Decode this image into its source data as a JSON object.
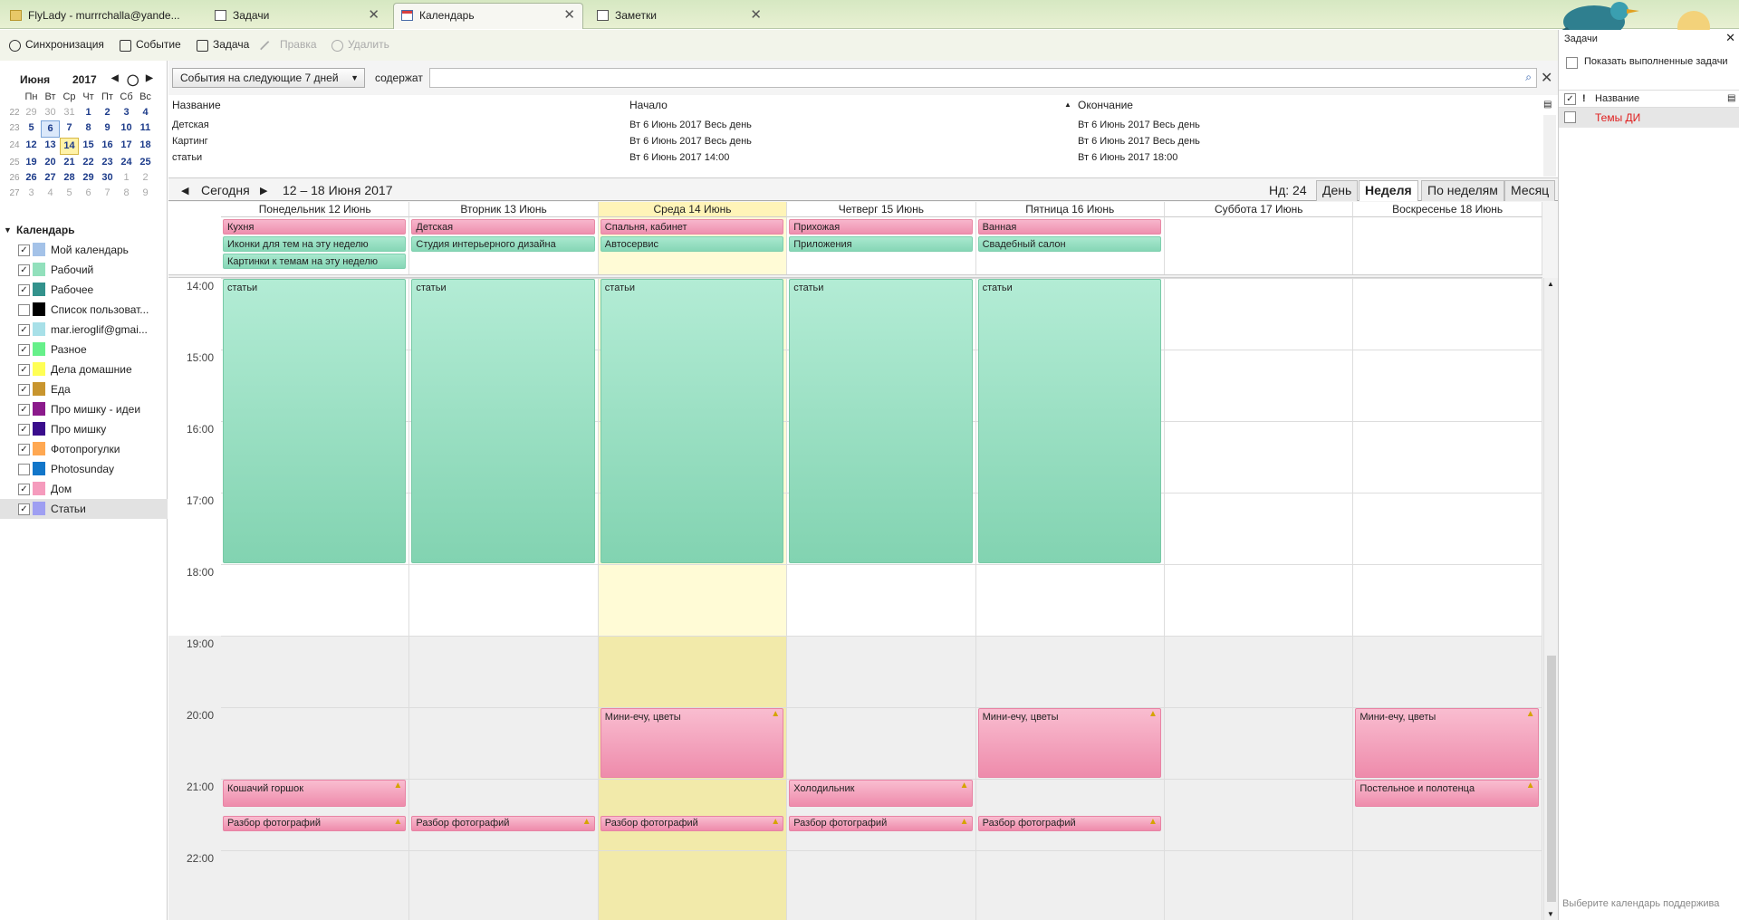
{
  "tabs": [
    {
      "label": "FlyLady - murrrchalla@yande...",
      "icon": "folder-icon"
    },
    {
      "label": "Задачи",
      "icon": "tasks-icon"
    },
    {
      "label": "Календарь",
      "icon": "calendar-icon"
    },
    {
      "label": "Заметки",
      "icon": "notes-icon"
    }
  ],
  "toolbar": {
    "sync": "Синхронизация",
    "event": "Событие",
    "task": "Задача",
    "edit": "Правка",
    "delete": "Удалить"
  },
  "mini_calendar": {
    "month": "Июня",
    "year": "2017",
    "weekdays": [
      "Пн",
      "Вт",
      "Ср",
      "Чт",
      "Пт",
      "Сб",
      "Вс"
    ],
    "weeks": [
      {
        "num": "22",
        "days": [
          "29",
          "30",
          "31",
          "1",
          "2",
          "3",
          "4"
        ]
      },
      {
        "num": "23",
        "days": [
          "5",
          "6",
          "7",
          "8",
          "9",
          "10",
          "11"
        ]
      },
      {
        "num": "24",
        "days": [
          "12",
          "13",
          "14",
          "15",
          "16",
          "17",
          "18"
        ]
      },
      {
        "num": "25",
        "days": [
          "19",
          "20",
          "21",
          "22",
          "23",
          "24",
          "25"
        ]
      },
      {
        "num": "26",
        "days": [
          "26",
          "27",
          "28",
          "29",
          "30",
          "1",
          "2"
        ]
      },
      {
        "num": "27",
        "days": [
          "3",
          "4",
          "5",
          "6",
          "7",
          "8",
          "9"
        ]
      }
    ]
  },
  "calendars": {
    "header": "Календарь",
    "items": [
      {
        "name": "Мой календарь",
        "color": "#a4c2e8",
        "checked": true
      },
      {
        "name": "Рабочий",
        "color": "#92e0bc",
        "checked": true
      },
      {
        "name": "Рабочее",
        "color": "#33928c",
        "checked": true
      },
      {
        "name": "Список пользоват...",
        "color": "#000000",
        "checked": false
      },
      {
        "name": "mar.ieroglif@gmai...",
        "color": "#a8e0e8",
        "checked": true
      },
      {
        "name": "Разное",
        "color": "#66f08a",
        "checked": true
      },
      {
        "name": "Дела домашние",
        "color": "#ffff55",
        "checked": true
      },
      {
        "name": "Еда",
        "color": "#c8952e",
        "checked": true
      },
      {
        "name": "Про мишку - идеи",
        "color": "#8b1a8b",
        "checked": true
      },
      {
        "name": "Про мишку",
        "color": "#3a0d8c",
        "checked": true
      },
      {
        "name": "Фотопрогулки",
        "color": "#ffa852",
        "checked": true
      },
      {
        "name": "Photosunday",
        "color": "#1276c9",
        "checked": false
      },
      {
        "name": "Дом",
        "color": "#f59bbd",
        "checked": true
      },
      {
        "name": "Статьи",
        "color": "#9f9ff2",
        "checked": true
      }
    ]
  },
  "filter": {
    "range": "События на следующие 7 дней",
    "contains": "содержат"
  },
  "event_list": {
    "headers": {
      "name": "Название",
      "start": "Начало",
      "end": "Окончание"
    },
    "rows": [
      {
        "name": "Детская",
        "start": "Вт 6 Июнь 2017 Весь день",
        "end": "Вт 6 Июнь 2017 Весь день"
      },
      {
        "name": "Картинг",
        "start": "Вт 6 Июнь 2017 Весь день",
        "end": "Вт 6 Июнь 2017 Весь день"
      },
      {
        "name": "статьи",
        "start": "Вт 6 Июнь 2017 14:00",
        "end": "Вт 6 Июнь 2017 18:00"
      }
    ]
  },
  "view": {
    "today": "Сегодня",
    "range": "12 – 18 Июня 2017",
    "week_num": "Нд: 24",
    "tabs": [
      "День",
      "Неделя",
      "По неделям",
      "Месяц"
    ]
  },
  "days": [
    {
      "label": "Понедельник 12 Июнь",
      "today": false
    },
    {
      "label": "Вторник 13 Июнь",
      "today": false
    },
    {
      "label": "Среда 14 Июнь",
      "today": true
    },
    {
      "label": "Четверг 15 Июнь",
      "today": false
    },
    {
      "label": "Пятница 16 Июнь",
      "today": false
    },
    {
      "label": "Суббота 17 Июнь",
      "today": false
    },
    {
      "label": "Воскресенье 18 Июнь",
      "today": false
    }
  ],
  "allday_events": [
    {
      "day": 0,
      "row": 0,
      "title": "Кухня",
      "color": "pink"
    },
    {
      "day": 0,
      "row": 1,
      "title": "Иконки для тем на эту неделю",
      "color": "green"
    },
    {
      "day": 0,
      "row": 2,
      "title": "Картинки к темам на эту неделю",
      "color": "green"
    },
    {
      "day": 1,
      "row": 0,
      "title": "Детская",
      "color": "pink"
    },
    {
      "day": 1,
      "row": 1,
      "title": "Студия интерьерного дизайна",
      "color": "green"
    },
    {
      "day": 2,
      "row": 0,
      "title": "Спальня, кабинет",
      "color": "pink"
    },
    {
      "day": 2,
      "row": 1,
      "title": "Автосервис",
      "color": "green"
    },
    {
      "day": 3,
      "row": 0,
      "title": "Прихожая",
      "color": "pink"
    },
    {
      "day": 3,
      "row": 1,
      "title": "Приложения",
      "color": "green"
    },
    {
      "day": 4,
      "row": 0,
      "title": "Ванная",
      "color": "pink"
    },
    {
      "day": 4,
      "row": 1,
      "title": "Свадебный салон",
      "color": "green"
    }
  ],
  "hours": [
    "14:00",
    "15:00",
    "16:00",
    "17:00",
    "18:00",
    "19:00",
    "20:00",
    "21:00",
    "22:00"
  ],
  "timed_events": [
    {
      "day": 0,
      "start": 14,
      "end": 18,
      "title": "статьи",
      "color": "green",
      "bell": false
    },
    {
      "day": 1,
      "start": 14,
      "end": 18,
      "title": "статьи",
      "color": "green",
      "bell": false
    },
    {
      "day": 2,
      "start": 14,
      "end": 18,
      "title": "статьи",
      "color": "green",
      "bell": false
    },
    {
      "day": 3,
      "start": 14,
      "end": 18,
      "title": "статьи",
      "color": "green",
      "bell": false
    },
    {
      "day": 4,
      "start": 14,
      "end": 18,
      "title": "статьи",
      "color": "green",
      "bell": false
    },
    {
      "day": 2,
      "start": 20,
      "end": 21,
      "title": "Мини-ечу, цветы",
      "color": "pink",
      "bell": true
    },
    {
      "day": 4,
      "start": 20,
      "end": 21,
      "title": "Мини-ечу, цветы",
      "color": "pink",
      "bell": true
    },
    {
      "day": 6,
      "start": 20,
      "end": 21,
      "title": "Мини-ечу, цветы",
      "color": "pink",
      "bell": true
    },
    {
      "day": 0,
      "start": 21,
      "end": 21.4,
      "title": "Кошачий горшок",
      "color": "pink",
      "bell": true
    },
    {
      "day": 3,
      "start": 21,
      "end": 21.4,
      "title": "Холодильник",
      "color": "pink",
      "bell": true
    },
    {
      "day": 6,
      "start": 21,
      "end": 21.4,
      "title": "Постельное и полотенца",
      "color": "pink",
      "bell": true
    },
    {
      "day": 0,
      "start": 21.5,
      "end": 21.75,
      "title": "Разбор фотографий",
      "color": "pink",
      "bell": true
    },
    {
      "day": 1,
      "start": 21.5,
      "end": 21.75,
      "title": "Разбор фотографий",
      "color": "pink",
      "bell": true
    },
    {
      "day": 2,
      "start": 21.5,
      "end": 21.75,
      "title": "Разбор фотографий",
      "color": "pink",
      "bell": true
    },
    {
      "day": 3,
      "start": 21.5,
      "end": 21.75,
      "title": "Разбор фотографий",
      "color": "pink",
      "bell": true
    },
    {
      "day": 4,
      "start": 21.5,
      "end": 21.75,
      "title": "Разбор фотографий",
      "color": "pink",
      "bell": true
    }
  ],
  "tasks_pane": {
    "title": "Задачи",
    "show_completed": "Показать выполненные задачи",
    "column": "Название",
    "tasks": [
      {
        "title": "Темы ДИ",
        "color": "#e02020"
      }
    ],
    "footer": "Выберите календарь поддержива"
  }
}
